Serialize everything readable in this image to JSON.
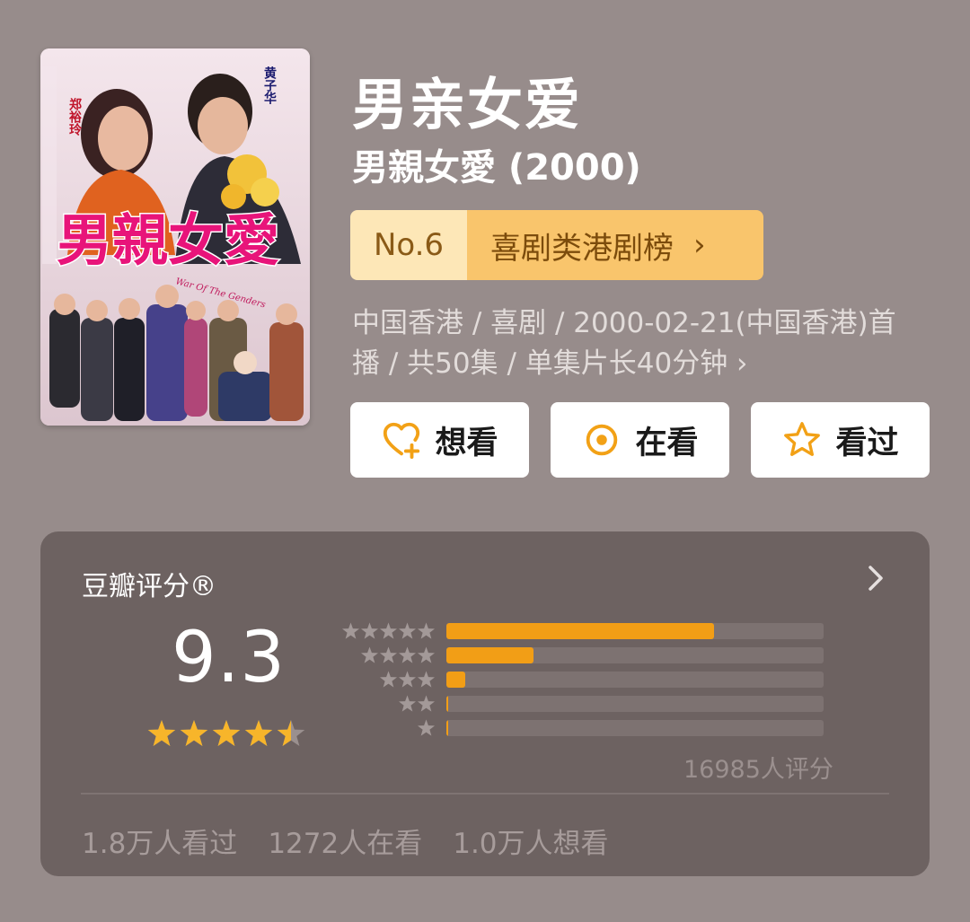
{
  "poster": {
    "title_art": "男親女愛",
    "cast_left": "郑裕玲",
    "cast_right": "黄子华",
    "tagline": "War Of The Genders"
  },
  "title": {
    "main": "男亲女爱",
    "original": "男親女愛 (2000)"
  },
  "rank": {
    "number": "No.6",
    "label": "喜剧类港剧榜"
  },
  "meta": {
    "line1": "中国香港 / 喜剧 / 2000-02-21(中国香港)首",
    "line2": "播 / 共50集 / 单集片长40分钟 ›"
  },
  "actions": [
    {
      "label": "想看",
      "icon": "heart-plus-icon"
    },
    {
      "label": "在看",
      "icon": "target-circle-icon"
    },
    {
      "label": "看过",
      "icon": "star-outline-icon"
    }
  ],
  "rating": {
    "title": "豆瓣评分®",
    "score": "9.3",
    "stars": 4.5,
    "distribution": [
      {
        "stars": 5,
        "fraction": 0.71
      },
      {
        "stars": 4,
        "fraction": 0.23
      },
      {
        "stars": 3,
        "fraction": 0.05
      },
      {
        "stars": 2,
        "fraction": 0.005
      },
      {
        "stars": 1,
        "fraction": 0.005
      }
    ],
    "count": "16985人评分",
    "stats": {
      "watched": "1.8万人看过",
      "watching": "1272人在看",
      "wish": "1.0万人想看"
    }
  },
  "colors": {
    "background": "#978c8b",
    "card": "#6d6261",
    "accent_orange": "#f29e16",
    "star_yellow": "#f7b52a",
    "rank_light": "#fde7b7",
    "rank_dark": "#f9c56c"
  }
}
